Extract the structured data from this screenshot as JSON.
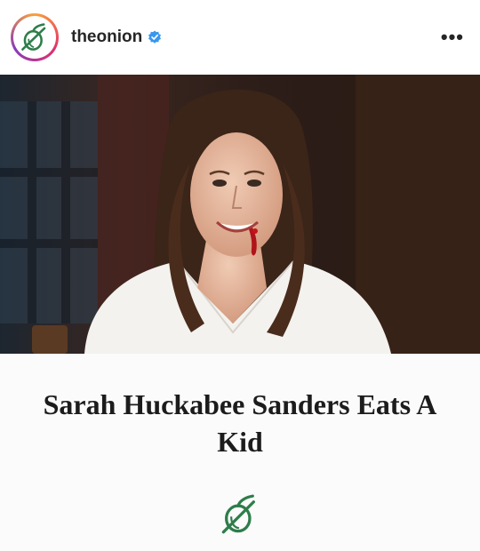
{
  "post": {
    "username": "theonion",
    "verified": true,
    "more_label": "•••"
  },
  "headline": {
    "text": "Sarah Huckabee Sanders Eats A Kid"
  },
  "colors": {
    "onion_green": "#2e7d4a",
    "verified_blue": "#3897f0",
    "ring_colors": [
      "#f9a23a",
      "#e1306c",
      "#8a3ab9"
    ]
  },
  "icons": {
    "avatar": "onion-logo-icon",
    "verified": "verified-badge-icon",
    "more": "more-options-icon",
    "footer": "onion-logo-icon"
  }
}
